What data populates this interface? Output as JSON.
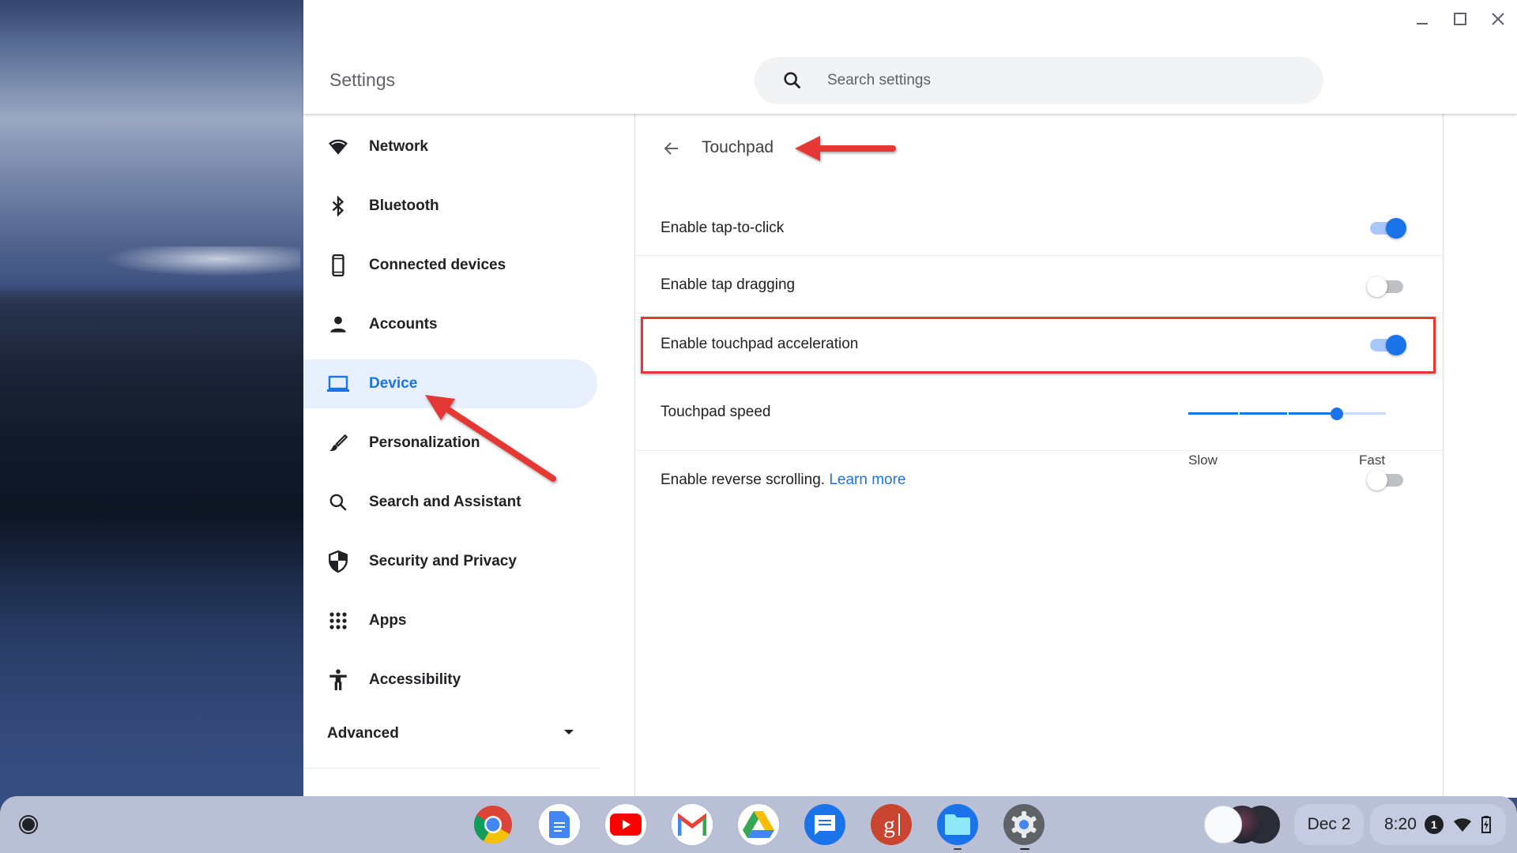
{
  "window": {
    "app_title": "Settings",
    "controls": {
      "minimize": "minimize-icon",
      "maximize": "maximize-icon",
      "close": "close-icon"
    }
  },
  "search": {
    "placeholder": "Search settings",
    "value": "",
    "icon": "search-icon"
  },
  "sidebar": {
    "items": [
      {
        "label": "Network",
        "icon": "wifi-icon",
        "active": false
      },
      {
        "label": "Bluetooth",
        "icon": "bluetooth-icon",
        "active": false
      },
      {
        "label": "Connected devices",
        "icon": "phone-icon",
        "active": false
      },
      {
        "label": "Accounts",
        "icon": "person-icon",
        "active": false
      },
      {
        "label": "Device",
        "icon": "laptop-icon",
        "active": true
      },
      {
        "label": "Personalization",
        "icon": "brush-icon",
        "active": false
      },
      {
        "label": "Search and Assistant",
        "icon": "search-icon",
        "active": false
      },
      {
        "label": "Security and Privacy",
        "icon": "shield-icon",
        "active": false
      },
      {
        "label": "Apps",
        "icon": "apps-grid-icon",
        "active": false
      },
      {
        "label": "Accessibility",
        "icon": "accessibility-icon",
        "active": false
      }
    ],
    "advanced_label": "Advanced"
  },
  "page": {
    "title": "Touchpad",
    "back_icon": "back-arrow-icon",
    "settings": [
      {
        "label": "Enable tap-to-click",
        "type": "toggle",
        "on": true
      },
      {
        "label": "Enable tap dragging",
        "type": "toggle",
        "on": false
      },
      {
        "label": "Enable touchpad acceleration",
        "type": "toggle",
        "on": true,
        "highlighted": true
      },
      {
        "label": "Touchpad speed",
        "type": "slider",
        "min_label": "Slow",
        "max_label": "Fast",
        "steps": 5,
        "value_index": 3
      },
      {
        "label": "Enable reverse scrolling.",
        "link": "Learn more",
        "type": "toggle",
        "on": false
      }
    ]
  },
  "colors": {
    "accent": "#1a73e8",
    "annotation": "#e53935",
    "active_nav_bg": "#e8f0fe"
  },
  "shelf": {
    "launcher_icon": "launcher-icon",
    "apps": [
      {
        "name": "Chrome",
        "icon": "chrome-icon",
        "running": false
      },
      {
        "name": "Docs",
        "icon": "docs-icon",
        "running": false
      },
      {
        "name": "YouTube",
        "icon": "youtube-icon",
        "running": false
      },
      {
        "name": "Gmail",
        "icon": "gmail-icon",
        "running": false
      },
      {
        "name": "Drive",
        "icon": "drive-icon",
        "running": false
      },
      {
        "name": "Messages",
        "icon": "messages-icon",
        "running": false
      },
      {
        "name": "g",
        "icon": "g-app-icon",
        "running": false
      },
      {
        "name": "Files",
        "icon": "files-icon",
        "running": true
      },
      {
        "name": "Settings",
        "icon": "settings-gear-icon",
        "running": true
      }
    ],
    "date": "Dec 2",
    "time": "8:20",
    "notification_count": "1"
  }
}
